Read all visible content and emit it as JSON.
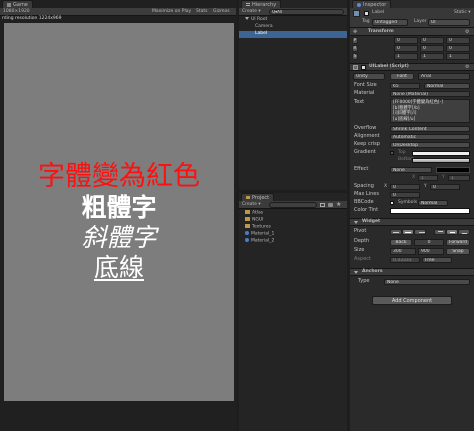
{
  "game": {
    "tab": "Game",
    "aspect": "1080×1920",
    "buttons": [
      "Maximize on Play",
      "Stats",
      "Gizmos"
    ],
    "warning": "rding resolution 1224x969",
    "labels": {
      "red": "字體變為紅色",
      "bold": "粗體字",
      "italic": "斜體字",
      "underline": "底線"
    },
    "red_color": "#ff1010",
    "bg_color": "#7d7d7d"
  },
  "hierarchy": {
    "tab": "Hierarchy",
    "create": "Create ▾",
    "search": "Q▾All",
    "items": [
      "UI Root",
      "Camera",
      "Label"
    ],
    "selected": "Label"
  },
  "project": {
    "tab": "Project",
    "create": "Create ▾",
    "items": [
      "Atlas",
      "NGUI",
      "Textures",
      "Material_1",
      "Material_2"
    ]
  },
  "inspector": {
    "tab": "Inspector",
    "object_name": "Label",
    "static_label": "Static ▾",
    "tag_label": "Tag",
    "tag_value": "Untagged",
    "layer_label": "Layer",
    "layer_value": "UI",
    "transform": {
      "title": "Transform",
      "rows": [
        {
          "label": "P",
          "x": "0",
          "y": "0",
          "z": "0"
        },
        {
          "label": "R",
          "x": "0",
          "y": "0",
          "z": "0"
        },
        {
          "label": "S",
          "x": "1",
          "y": "1",
          "z": "1"
        }
      ]
    },
    "uilabel": {
      "title": "UILabel (Script)",
      "font_type": "Unity",
      "font_btn": "Font",
      "font_value": "Arial",
      "font_size_label": "Font Size",
      "font_size": "65",
      "font_style": "Normal",
      "material_label": "Material",
      "material_value": "None (Material)",
      "text_label": "Text",
      "text_lines": [
        "[FF0000]字體變為紅色[-]",
        "[b]粗體字[/b]",
        "[i]斜體字[/i]",
        "[u]底線[/u]"
      ],
      "overflow_label": "Overflow",
      "overflow_value": "Shrink Content",
      "alignment_label": "Alignment",
      "alignment_value": "Automatic",
      "keepcrisp_label": "Keep crisp",
      "keepcrisp_value": "OnDesktop",
      "gradient_label": "Gradient",
      "gradient_top": "Top",
      "gradient_bottom": "Bottom",
      "effect_label": "Effect",
      "effect_value": "None",
      "effect_x": "X",
      "effect_y": "Y",
      "effect_x_val": "1",
      "effect_y_val": "1",
      "spacing_label": "Spacing",
      "spacing_x": "X",
      "spacing_x_val": "0",
      "spacing_y": "Y",
      "spacing_y_val": "0",
      "maxlines_label": "Max Lines",
      "maxlines_value": "0",
      "bbcode_label": "BBCode",
      "symbols_label": "Symbols",
      "symbols_value": "Normal",
      "colortint_label": "Color Tint"
    },
    "widget": {
      "title": "Widget",
      "pivot_label": "Pivot",
      "depth_label": "Depth",
      "depth_back": "Back",
      "depth_value": "0",
      "depth_forward": "Forward",
      "size_label": "Size",
      "size_w": "300",
      "size_h": "900",
      "snap": "Snap",
      "aspect_label": "Aspect",
      "aspect_value": "0.33333",
      "aspect_mode": "Free"
    },
    "anchors": {
      "title": "Anchors",
      "type_label": "Type",
      "type_value": "None"
    },
    "add_component": "Add Component"
  }
}
